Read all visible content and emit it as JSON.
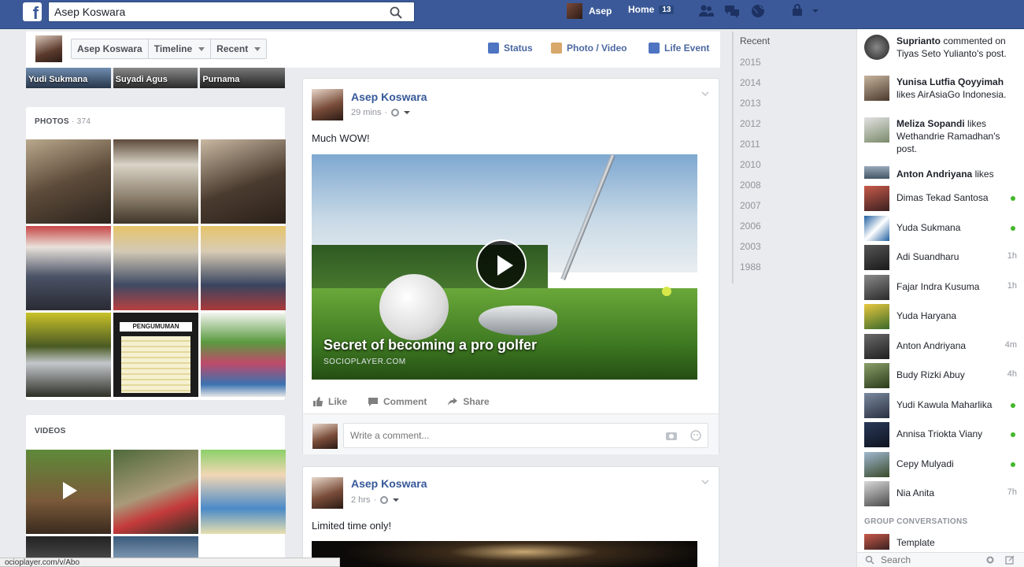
{
  "topbar": {
    "search_value": "Asep Koswara",
    "user_name": "Asep",
    "home_label": "Home",
    "home_count": "13",
    "logo": "f"
  },
  "profile_strip": {
    "name": "Asep Koswara",
    "timeline_label": "Timeline",
    "recent_label": "Recent",
    "status_label": "Status",
    "photo_video_label": "Photo / Video",
    "life_event_label": "Life Event"
  },
  "friends": [
    "Yudi Sukmana",
    "Suyadi Agus",
    "Purnama"
  ],
  "photos": {
    "title": "PHOTOS",
    "sep": " · ",
    "count": "374"
  },
  "photo_banner_text": "PENGUMUMAN",
  "videos": {
    "title": "VIDEOS"
  },
  "posts": [
    {
      "author": "Asep Koswara",
      "time": "29 mins",
      "text": "Much WOW!",
      "video_title": "Secret of becoming a pro golfer",
      "video_domain": "SOCIOPLAYER.COM"
    },
    {
      "author": "Asep Koswara",
      "time": "2 hrs",
      "text": "Limited time only!"
    }
  ],
  "post_actions": {
    "like": "Like",
    "comment": "Comment",
    "share": "Share"
  },
  "comment_placeholder": "Write a comment...",
  "timeline_years": [
    "Recent",
    "2015",
    "2014",
    "2013",
    "2012",
    "2011",
    "2010",
    "2008",
    "2007",
    "2006",
    "2003",
    "1988"
  ],
  "ticker": [
    {
      "name": "Suprianto",
      "rest": " commented on Tiyas Seto Yulianto's post."
    },
    {
      "name": "Yunisa Lutfia Qoyyimah",
      "rest": " likes AirAsiaGo Indonesia."
    },
    {
      "name": "Meliza Sopandi",
      "rest": " likes Wethandrie Ramadhan's post."
    },
    {
      "name": "Anton Andriyana",
      "rest": " likes"
    }
  ],
  "chat": [
    {
      "name": "Dimas Tekad Santosa",
      "time": "",
      "online": true
    },
    {
      "name": "Yuda Sukmana",
      "time": "",
      "online": true
    },
    {
      "name": "Adi Suandharu",
      "time": "1h",
      "online": false
    },
    {
      "name": "Fajar Indra Kusuma",
      "time": "1h",
      "online": false
    },
    {
      "name": "Yuda Haryana",
      "time": "",
      "online": false
    },
    {
      "name": "Anton Andriyana",
      "time": "4m",
      "online": false
    },
    {
      "name": "Budy Rizki Abuy",
      "time": "4h",
      "online": false
    },
    {
      "name": "Yudi Kawula Maharlika",
      "time": "",
      "online": true
    },
    {
      "name": "Annisa Triokta Viany",
      "time": "",
      "online": true
    },
    {
      "name": "Cepy Mulyadi",
      "time": "",
      "online": true
    },
    {
      "name": "Nia Anita",
      "time": "7h",
      "online": false
    }
  ],
  "group_conversations": {
    "title": "GROUP CONVERSATIONS",
    "first": "Template"
  },
  "chat_search_placeholder": "Search",
  "status_url": "ocioplayer.com/v/Abo",
  "colors": {
    "brand": "#3b5998",
    "link": "#365899",
    "online": "#42b72a"
  }
}
